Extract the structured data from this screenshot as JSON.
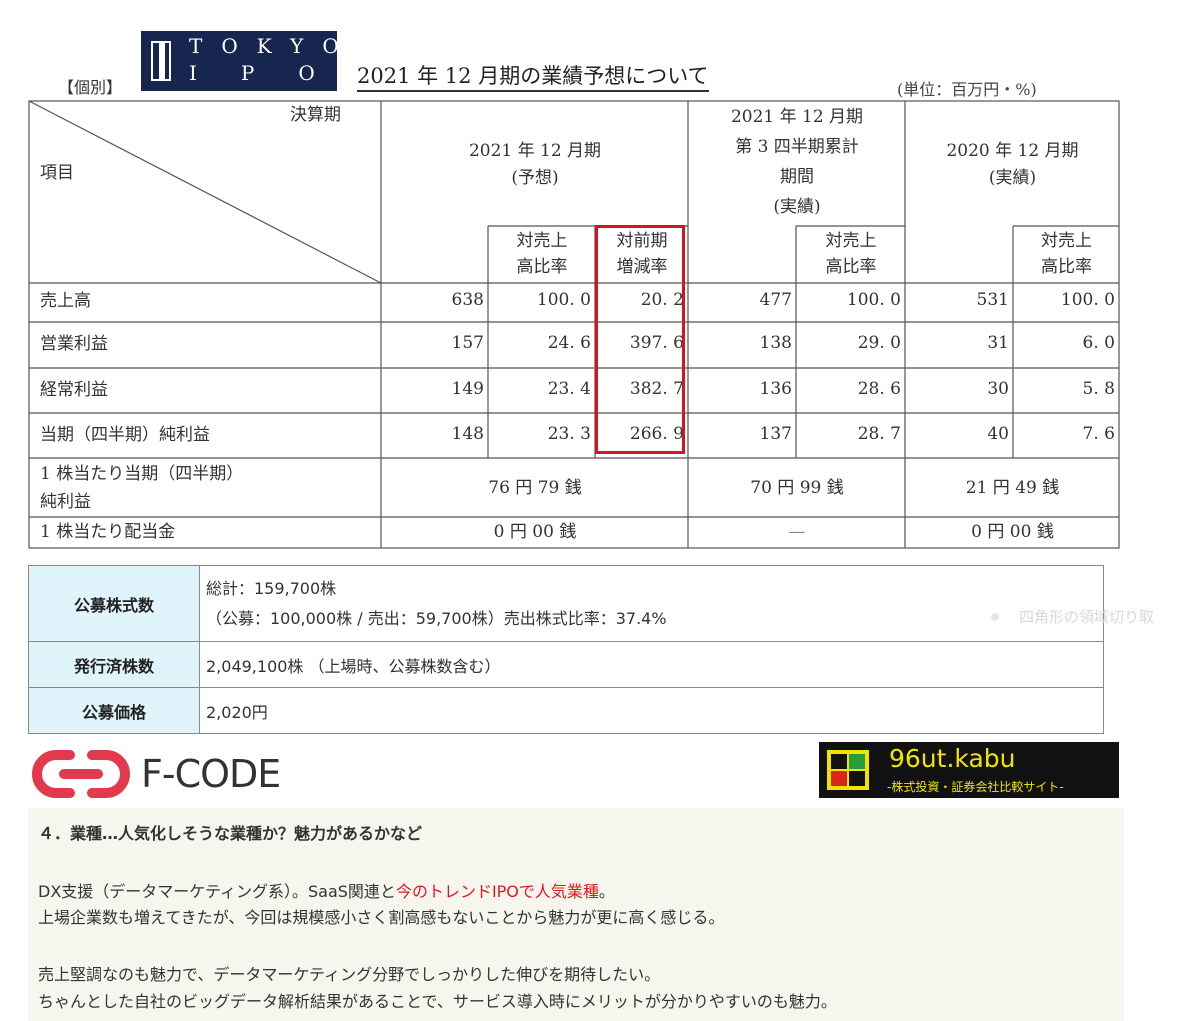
{
  "header": {
    "logo": {
      "line1": "TOKYO",
      "line2": "IPO"
    },
    "category": "【個別】",
    "title": "2021 年 12 月期の業績予想について",
    "unit_note": "(単位：百万円・%)"
  },
  "results_table": {
    "corner": {
      "top": "決算期",
      "bottom": "項目"
    },
    "period_headers": [
      {
        "lines": [
          "2021 年 12 月期",
          "(予想)"
        ]
      },
      {
        "lines": [
          "2021 年 12 月期",
          "第 3 四半期累計",
          "期間",
          "(実績)"
        ]
      },
      {
        "lines": [
          "2020 年 12 月期",
          "(実績)"
        ]
      }
    ],
    "sub_headers": {
      "sales_ratio": [
        "対売上",
        "高比率"
      ],
      "yoy_change": [
        "対前期",
        "増減率"
      ]
    },
    "rows": [
      {
        "label": "売上高",
        "f": "638",
        "f_ratio": "100. 0",
        "f_yoy": "20. 2",
        "q": "477",
        "q_ratio": "100. 0",
        "p": "531",
        "p_ratio": "100. 0"
      },
      {
        "label": "営業利益",
        "f": "157",
        "f_ratio": "24. 6",
        "f_yoy": "397. 6",
        "q": "138",
        "q_ratio": "29. 0",
        "p": "31",
        "p_ratio": "6. 0"
      },
      {
        "label": "経常利益",
        "f": "149",
        "f_ratio": "23. 4",
        "f_yoy": "382. 7",
        "q": "136",
        "q_ratio": "28. 6",
        "p": "30",
        "p_ratio": "5. 8"
      },
      {
        "label": "当期（四半期）純利益",
        "f": "148",
        "f_ratio": "23. 3",
        "f_yoy": "266. 9",
        "q": "137",
        "q_ratio": "28. 7",
        "p": "40",
        "p_ratio": "7. 6"
      }
    ],
    "eps": {
      "label_lines": [
        "1 株当たり当期（四半期）",
        "純利益"
      ],
      "f": "76 円 79 銭",
      "q": "70 円 99 銭",
      "p": "21 円 49 銭"
    },
    "dividend": {
      "label": "1 株当たり配当金",
      "f": "0 円 00 銭",
      "q": "—",
      "p": "0 円 00 銭"
    }
  },
  "offering": {
    "public_shares": {
      "label": "公募株式数",
      "line1": "総計：159,700株",
      "line2": "（公募：100,000株 / 売出：59,700株）売出株式比率：37.4%"
    },
    "issued_shares": {
      "label": "発行済株数",
      "value": "2,049,100株 （上場時、公募株数含む）"
    },
    "offer_price": {
      "label": "公募価格",
      "value": "2,020円"
    }
  },
  "faded_note": "四角形の領域切り取",
  "brands": {
    "fcode": "F-CODE",
    "kabu": {
      "name": "96ut.kabu",
      "tagline": "-株式投資・証券会社比較サイト-"
    }
  },
  "commentary": {
    "heading": "４．業種…人気化しそうな業種か？魅力があるかなど",
    "p1_a": "DX支援（データマーケティング系）。SaaS関連と",
    "p1_red": "今のトレンドIPOで人気業種",
    "p1_b": "。",
    "p2": "上場企業数も増えてきたが、今回は規模感小さく割高感もないことから魅力が更に高く感じる。",
    "p3": "売上堅調なのも魅力で、データマーケティング分野でしっかりした伸びを期待したい。",
    "p4": "ちゃんとした自社のビッグデータ解析結果があることで、サービス導入時にメリットが分かりやすいのも魅力。"
  },
  "colors": {
    "logo_bg": "#17264f",
    "highlight": "#d0171c",
    "label_bg": "#dff4fb",
    "kabu_text": "#f2e400",
    "fcode_red": "#e2394f",
    "comment_red": "#e4161b"
  }
}
